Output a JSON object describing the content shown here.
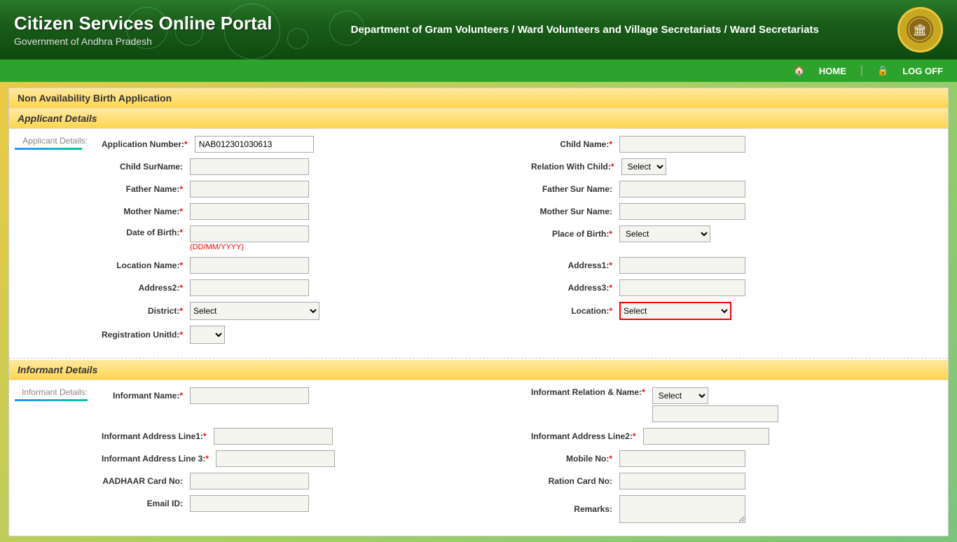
{
  "header": {
    "title": "Citizen Services Online Portal",
    "subtitle": "Government of Andhra Pradesh",
    "department": "Department of Gram Volunteers / Ward Volunteers and Village Secretariats / Ward Secretariats"
  },
  "navbar": {
    "home_label": "HOME",
    "logoff_label": "LOG OFF"
  },
  "page": {
    "section_title": "Non Availability Birth Application",
    "applicant_section": "Applicant Details",
    "applicant_side_label": "Applicant Details:",
    "informant_section": "Informant Details",
    "informant_side_label": "Informant Details:"
  },
  "form": {
    "application_number_label": "Application Number:",
    "application_number_value": "NAB012301030613",
    "child_name_label": "Child Name:",
    "child_surname_label": "Child SurName:",
    "relation_with_child_label": "Relation With Child:",
    "father_name_label": "Father Name:",
    "father_sur_name_label": "Father Sur Name:",
    "mother_name_label": "Mother Name:",
    "mother_sur_name_label": "Mother Sur Name:",
    "date_of_birth_label": "Date of Birth:",
    "date_hint": "(DD/MM/YYYY)",
    "place_of_birth_label": "Place of Birth:",
    "location_name_label": "Location Name:",
    "address1_label": "Address1:",
    "address2_label": "Address2:",
    "address3_label": "Address3:",
    "district_label": "District:",
    "location_label": "Location:",
    "reg_unit_label": "Registration UnitId:",
    "select_placeholder": "Select",
    "informant_name_label": "Informant Name:",
    "informant_relation_label": "Informant Relation & Name:",
    "informant_addr1_label": "Informant Address Line1:",
    "informant_addr2_label": "Informant Address Line2:",
    "informant_addr3_label": "Informant Address Line 3:",
    "mobile_no_label": "Mobile No:",
    "aadhaar_label": "AADHAAR Card No:",
    "ration_card_label": "Ration Card No:",
    "email_label": "Email ID:",
    "remarks_label": "Remarks:"
  },
  "select_options": [
    "Select"
  ],
  "place_of_birth_options": [
    "Select"
  ],
  "relation_options": [
    "Select"
  ],
  "district_options": [
    "Select"
  ]
}
